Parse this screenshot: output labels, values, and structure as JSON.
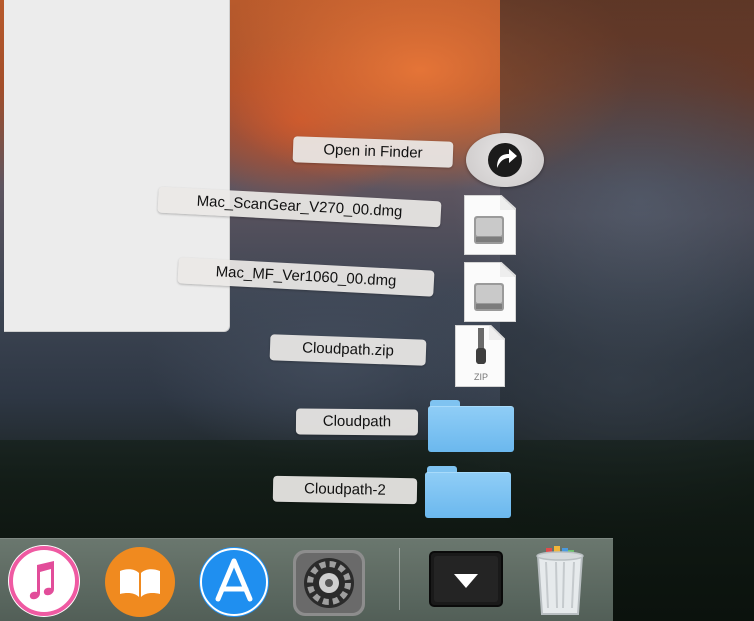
{
  "stack": {
    "open_in_finder": "Open in Finder",
    "items": [
      {
        "label": "Mac_ScanGear_V270_00.dmg",
        "type": "dmg"
      },
      {
        "label": "Mac_MF_Ver1060_00.dmg",
        "type": "dmg"
      },
      {
        "label": "Cloudpath.zip",
        "type": "zip",
        "badge": "ZIP"
      },
      {
        "label": "Cloudpath",
        "type": "folder"
      },
      {
        "label": "Cloudpath-2",
        "type": "folder"
      }
    ]
  },
  "dock": {
    "apps": [
      "itunes-icon",
      "ibooks-icon",
      "app-store-icon",
      "system-preferences-icon"
    ],
    "stack_icon": "downloads-stack-icon",
    "trash_icon": "trash-icon"
  },
  "colors": {
    "folder": "#78c0f0",
    "label_bg": "#ebe8e6",
    "app_store_blue": "#1f8ff0",
    "ibooks_orange": "#f08a1f",
    "itunes_pink": "#f05aa0"
  }
}
